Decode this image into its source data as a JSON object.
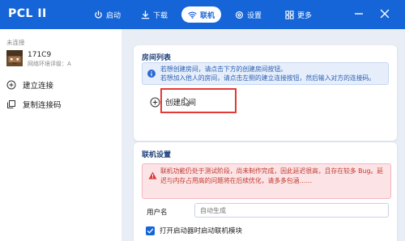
{
  "app": {
    "title": "PCL II"
  },
  "nav": {
    "launch": "启动",
    "download": "下载",
    "multiplayer": "联机",
    "settings": "设置",
    "more": "更多"
  },
  "sidebar": {
    "status": "未连接",
    "player": {
      "name": "171C9",
      "network": "网络环境评级：A"
    },
    "create_connection": "建立连接",
    "copy_code": "复制连接码"
  },
  "room_list": {
    "title": "房间列表",
    "info_line1": "若想创建房间，请点击下方的创建房间按钮。",
    "info_line2": "若想加入他人的房间，请点击左侧的建立连接按钮，然后输入对方的连接码。",
    "create_room": "创建房间"
  },
  "multiplayer_settings": {
    "title": "联机设置",
    "warning": "联机功能仍处于测试阶段，尚未制作完成，因此延迟很高，且存在较多 Bug。延迟与内存占用高的问题将在后续优化，请多多包涵……",
    "username_label": "用户名",
    "username_placeholder": "自动生成",
    "autostart_label": "打开启动器时启动联机模块",
    "autostart_checked": true
  },
  "colors": {
    "accent": "#1565d8",
    "warning": "#c0392b",
    "info": "#2a5fb0",
    "highlight": "#e53935"
  }
}
